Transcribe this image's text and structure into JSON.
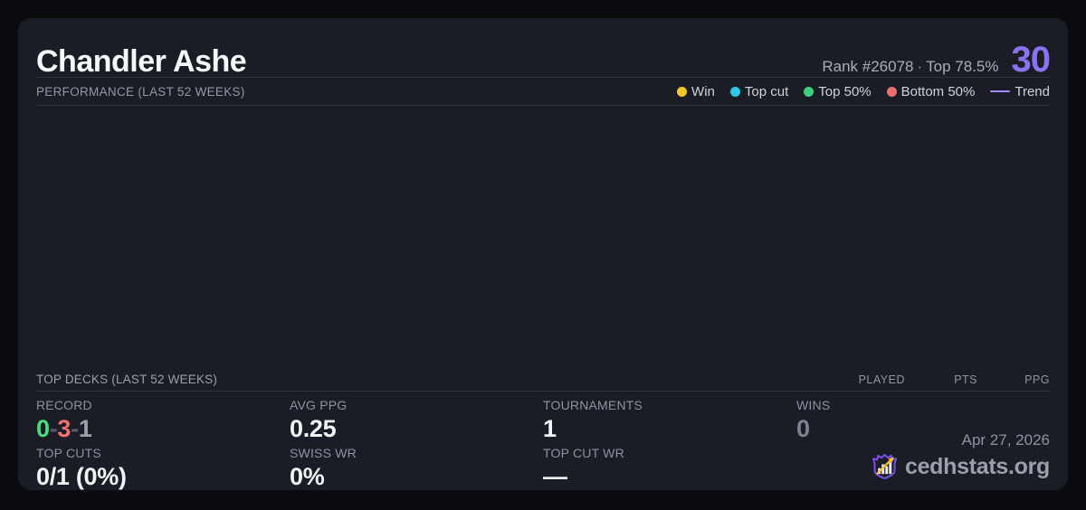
{
  "player": {
    "name": "Chandler Ashe",
    "rank": "Rank #26078",
    "separator": "·",
    "top_percent": "Top 78.5%",
    "score": "30"
  },
  "performance": {
    "title": "PERFORMANCE (LAST 52 WEEKS)",
    "legend": [
      {
        "label": "Win",
        "color": "#f2c72a",
        "type": "dot"
      },
      {
        "label": "Top cut",
        "color": "#2ec9e8",
        "type": "dot"
      },
      {
        "label": "Top 50%",
        "color": "#3ed17d",
        "type": "dot"
      },
      {
        "label": "Bottom 50%",
        "color": "#f06d6d",
        "type": "dot"
      },
      {
        "label": "Trend",
        "color": "#a78bfa",
        "type": "line"
      }
    ]
  },
  "top_decks": {
    "title": "TOP DECKS (LAST 52 WEEKS)",
    "columns": [
      "PLAYED",
      "PTS",
      "PPG"
    ],
    "rows": []
  },
  "stats": {
    "record": {
      "label": "RECORD",
      "wins": "0",
      "losses": "3",
      "draws": "1",
      "sep": "-"
    },
    "avg_ppg": {
      "label": "AVG PPG",
      "value": "0.25"
    },
    "tournaments": {
      "label": "TOURNAMENTS",
      "value": "1"
    },
    "wins": {
      "label": "WINS",
      "value": "0"
    },
    "top_cuts": {
      "label": "TOP CUTS",
      "value": "0/1 (0%)"
    },
    "swiss_wr": {
      "label": "SWISS WR",
      "value": "0%"
    },
    "top_cut_wr": {
      "label": "TOP CUT WR",
      "value": "—"
    }
  },
  "footer": {
    "date": "Apr 27, 2026",
    "brand": "cedhstats.org"
  },
  "colors": {
    "accent_purple": "#8b72f0",
    "win_green": "#4ade80",
    "loss_red": "#f07171",
    "draw_gray": "#9aa1ae",
    "card_bg": "#1a1c26",
    "page_bg": "#0b0c10"
  }
}
